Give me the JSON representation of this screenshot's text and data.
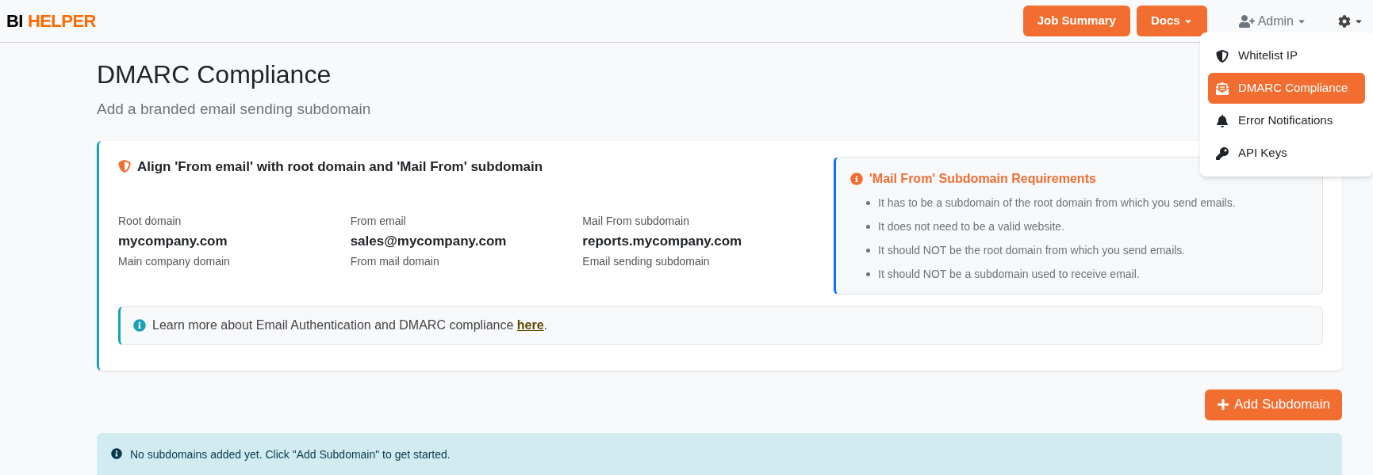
{
  "logo": {
    "first": "BI",
    "second": "HELPER"
  },
  "nav": {
    "buttons": [
      {
        "label": "Job Summary",
        "kind": "plain"
      },
      {
        "label": "Docs",
        "kind": "dropdown"
      }
    ],
    "user": "Admin"
  },
  "settings_menu": {
    "items": [
      {
        "label": "Whitelist IP",
        "kind": "shield",
        "selected": false
      },
      {
        "label": "DMARC Compliance",
        "kind": "envelope",
        "selected": true
      },
      {
        "label": "Error Notifications",
        "kind": "bell",
        "selected": false
      },
      {
        "label": "API Keys",
        "kind": "key",
        "selected": false
      }
    ]
  },
  "page": {
    "title": "DMARC Compliance",
    "subtitle": "Add a branded email sending subdomain"
  },
  "card": {
    "title": "Align 'From email' with root domain and 'Mail From' subdomain",
    "fields": [
      {
        "label": "Root domain",
        "value": "mycompany.com",
        "hint": "Main company domain"
      },
      {
        "label": "From email",
        "value": "sales@mycompany.com",
        "hint": "From mail domain"
      },
      {
        "label": "Mail From subdomain",
        "value": "reports.mycompany.com",
        "hint": "Email sending subdomain"
      }
    ],
    "requirements": {
      "title": "'Mail From' Subdomain Requirements",
      "items": [
        "It has to be a subdomain of the root domain from which you send emails.",
        "It does not need to be a valid website.",
        "It should NOT be the root domain from which you send emails.",
        "It should NOT be a subdomain used to receive email."
      ]
    },
    "learn_more": {
      "text": "Learn more about Email Authentication and DMARC compliance ",
      "link": "here",
      "after": "."
    }
  },
  "add_button": "Add Subdomain",
  "empty_alert": "No subdomains added yet. Click \"Add Subdomain\" to get started."
}
